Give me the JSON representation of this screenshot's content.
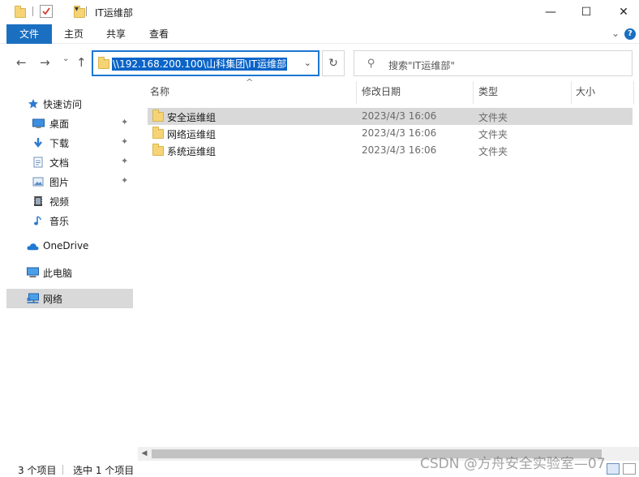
{
  "window": {
    "title": "IT运维部",
    "minimize": "—",
    "maximize": "☐",
    "close": "✕"
  },
  "ribbon": {
    "tabs": [
      "文件",
      "主页",
      "共享",
      "查看"
    ],
    "expand": "⌄",
    "help": "?"
  },
  "nav": {
    "back": "←",
    "forward": "→",
    "recent": "⌄",
    "up": "↑",
    "address": "\\\\192.168.200.100\\山科集团\\IT运维部",
    "address_dropdown": "⌄",
    "refresh": "↻",
    "search_placeholder": "搜索\"IT运维部\""
  },
  "sidebar": {
    "items": [
      {
        "label": "快速访问",
        "icon": "star-icon"
      },
      {
        "label": "桌面",
        "icon": "desktop-icon",
        "pinned": true
      },
      {
        "label": "下载",
        "icon": "download-icon",
        "pinned": true
      },
      {
        "label": "文档",
        "icon": "document-icon",
        "pinned": true
      },
      {
        "label": "图片",
        "icon": "picture-icon",
        "pinned": true
      },
      {
        "label": "视频",
        "icon": "video-icon"
      },
      {
        "label": "音乐",
        "icon": "music-icon"
      },
      {
        "label": "OneDrive",
        "icon": "cloud-icon"
      },
      {
        "label": "此电脑",
        "icon": "computer-icon"
      },
      {
        "label": "网络",
        "icon": "network-icon",
        "selected": true
      }
    ],
    "pin_glyph": "📌"
  },
  "columns": {
    "name": "名称",
    "modified": "修改日期",
    "type": "类型",
    "size": "大小",
    "sort_indicator": "^"
  },
  "files": [
    {
      "name": "安全运维组",
      "modified": "2023/4/3 16:06",
      "type": "文件夹",
      "selected": true
    },
    {
      "name": "网络运维组",
      "modified": "2023/4/3 16:06",
      "type": "文件夹"
    },
    {
      "name": "系统运维组",
      "modified": "2023/4/3 16:06",
      "type": "文件夹"
    }
  ],
  "scroll": {
    "left_arrow": "◀"
  },
  "status": {
    "count": "3 个项目",
    "selected": "选中 1 个项目",
    "watermark": "CSDN @方舟安全实验室—07"
  },
  "colors": {
    "accent": "#1a6fc0",
    "selection": "#d9d9d9",
    "folder": "#f6d476"
  }
}
